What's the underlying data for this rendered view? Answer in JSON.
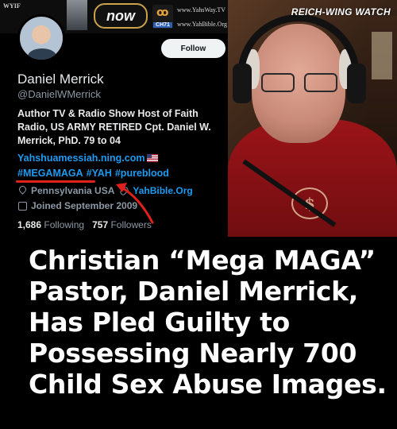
{
  "banner": {
    "left_text": "WYIF",
    "logo_text": "now",
    "channel_number": "CH71",
    "url_top": "www.YahsWay.TV",
    "url_bottom": "www.YahBible.Org"
  },
  "profile": {
    "follow_label": "Follow",
    "display_name": "Daniel Merrick",
    "handle": "@DanielWMerrick",
    "bio": "Author TV & Radio Show Host of Faith Radio, US ARMY RETIRED Cpt. Daniel W. Merrick, PhD. 79 to 04",
    "website": "Yahshuamessiah.ning.com",
    "hashtags": [
      "#MEGAMAGA",
      "#YAH",
      "#pureblood"
    ],
    "location": "Pennsylvania USA",
    "profile_link": "YahBible.Org",
    "joined": "Joined September 2009",
    "following_count": "1,686",
    "following_label": "Following",
    "followers_count": "757",
    "followers_label": "Followers"
  },
  "photo": {
    "watermark": "REICH-WING WATCH"
  },
  "headline": {
    "lines": [
      "Christian “Mega MAGA”",
      "Pastor, Daniel Merrick,",
      "Has Pled Guilty to",
      "Possessing Nearly 700",
      "Child Sex Abuse Images."
    ]
  },
  "colors": {
    "background": "#000000",
    "link_blue": "#1d9bf0",
    "secondary_text": "#8b98a5",
    "annotation_red": "#e0201a",
    "shirt_red": "#9b1418"
  }
}
